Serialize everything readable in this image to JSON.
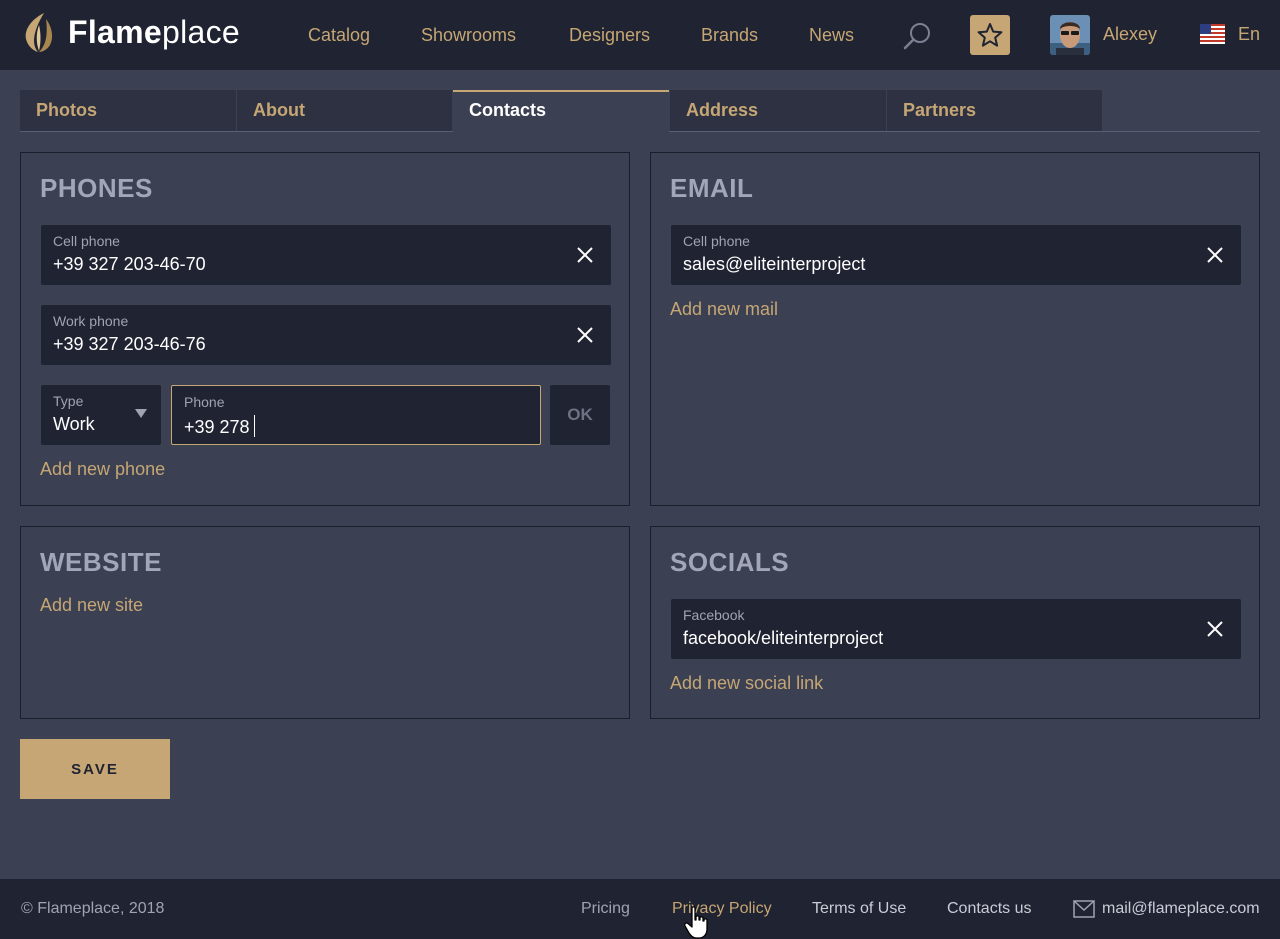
{
  "brand": {
    "name_bold": "Flame",
    "name_light": "place",
    "accent": "#c5a674"
  },
  "nav": [
    {
      "label": "Catalog"
    },
    {
      "label": "Showrooms"
    },
    {
      "label": "Designers"
    },
    {
      "label": "Brands"
    },
    {
      "label": "News"
    }
  ],
  "header": {
    "search_icon": "search-icon",
    "favorites_icon": "star-icon",
    "user_name": "Alexey",
    "language": "En"
  },
  "tabs": [
    {
      "label": "Photos",
      "active": false
    },
    {
      "label": "About",
      "active": false
    },
    {
      "label": "Contacts",
      "active": true
    },
    {
      "label": "Address",
      "active": false
    },
    {
      "label": "Partners",
      "active": false
    }
  ],
  "phones": {
    "title": "PHONES",
    "items": [
      {
        "label": "Cell phone",
        "value": "+39 327 203-46-70"
      },
      {
        "label": "Work phone",
        "value": "+39 327 203-46-76"
      }
    ],
    "new_entry": {
      "type_label": "Type",
      "type_value": "Work",
      "phone_label": "Phone",
      "phone_value": "+39 278",
      "ok_label": "OK"
    },
    "add_label": "Add new phone"
  },
  "email": {
    "title": "EMAIL",
    "items": [
      {
        "label": "Cell phone",
        "value": "sales@eliteinterproject"
      }
    ],
    "add_label": "Add new mail"
  },
  "website": {
    "title": "WEBSITE",
    "add_label": "Add new site"
  },
  "socials": {
    "title": "SOCIALS",
    "items": [
      {
        "label": "Facebook",
        "value": "facebook/eliteinterproject"
      }
    ],
    "add_label": "Add new social link"
  },
  "save_label": "SAVE",
  "footer": {
    "copyright": "© Flameplace, 2018",
    "links": [
      {
        "label": "Pricing",
        "color": "#9fa3b2"
      },
      {
        "label": "Privacy Policy",
        "color": "#c5a674"
      },
      {
        "label": "Terms of Use",
        "color": "#c9ccd6"
      },
      {
        "label": "Contacts us",
        "color": "#c9ccd6"
      }
    ],
    "email": "mail@flameplace.com"
  }
}
